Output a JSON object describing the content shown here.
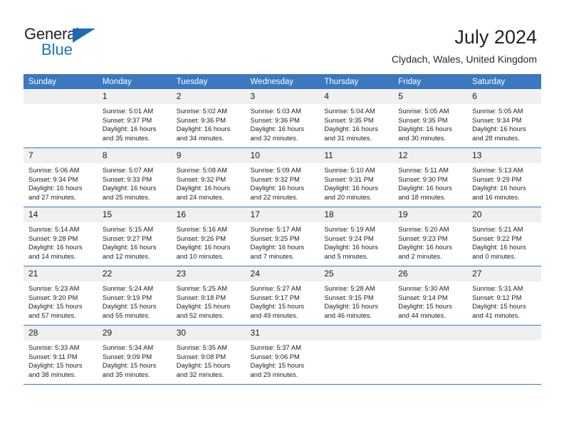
{
  "brand": {
    "name_part1": "General",
    "name_part2": "Blue"
  },
  "header": {
    "title": "July 2024",
    "location": "Clydach, Wales, United Kingdom"
  },
  "weekday_headers": [
    "Sunday",
    "Monday",
    "Tuesday",
    "Wednesday",
    "Thursday",
    "Friday",
    "Saturday"
  ],
  "colors": {
    "header_blue": "#3b78bf",
    "brand_blue": "#1b75bb",
    "daynum_bg": "#f0f0f0"
  },
  "weeks": [
    [
      {
        "day": "",
        "sunrise": "",
        "sunset": "",
        "daylight1": "",
        "daylight2": ""
      },
      {
        "day": "1",
        "sunrise": "Sunrise: 5:01 AM",
        "sunset": "Sunset: 9:37 PM",
        "daylight1": "Daylight: 16 hours",
        "daylight2": "and 35 minutes."
      },
      {
        "day": "2",
        "sunrise": "Sunrise: 5:02 AM",
        "sunset": "Sunset: 9:36 PM",
        "daylight1": "Daylight: 16 hours",
        "daylight2": "and 34 minutes."
      },
      {
        "day": "3",
        "sunrise": "Sunrise: 5:03 AM",
        "sunset": "Sunset: 9:36 PM",
        "daylight1": "Daylight: 16 hours",
        "daylight2": "and 32 minutes."
      },
      {
        "day": "4",
        "sunrise": "Sunrise: 5:04 AM",
        "sunset": "Sunset: 9:35 PM",
        "daylight1": "Daylight: 16 hours",
        "daylight2": "and 31 minutes."
      },
      {
        "day": "5",
        "sunrise": "Sunrise: 5:05 AM",
        "sunset": "Sunset: 9:35 PM",
        "daylight1": "Daylight: 16 hours",
        "daylight2": "and 30 minutes."
      },
      {
        "day": "6",
        "sunrise": "Sunrise: 5:05 AM",
        "sunset": "Sunset: 9:34 PM",
        "daylight1": "Daylight: 16 hours",
        "daylight2": "and 28 minutes."
      }
    ],
    [
      {
        "day": "7",
        "sunrise": "Sunrise: 5:06 AM",
        "sunset": "Sunset: 9:34 PM",
        "daylight1": "Daylight: 16 hours",
        "daylight2": "and 27 minutes."
      },
      {
        "day": "8",
        "sunrise": "Sunrise: 5:07 AM",
        "sunset": "Sunset: 9:33 PM",
        "daylight1": "Daylight: 16 hours",
        "daylight2": "and 25 minutes."
      },
      {
        "day": "9",
        "sunrise": "Sunrise: 5:08 AM",
        "sunset": "Sunset: 9:32 PM",
        "daylight1": "Daylight: 16 hours",
        "daylight2": "and 24 minutes."
      },
      {
        "day": "10",
        "sunrise": "Sunrise: 5:09 AM",
        "sunset": "Sunset: 9:32 PM",
        "daylight1": "Daylight: 16 hours",
        "daylight2": "and 22 minutes."
      },
      {
        "day": "11",
        "sunrise": "Sunrise: 5:10 AM",
        "sunset": "Sunset: 9:31 PM",
        "daylight1": "Daylight: 16 hours",
        "daylight2": "and 20 minutes."
      },
      {
        "day": "12",
        "sunrise": "Sunrise: 5:11 AM",
        "sunset": "Sunset: 9:30 PM",
        "daylight1": "Daylight: 16 hours",
        "daylight2": "and 18 minutes."
      },
      {
        "day": "13",
        "sunrise": "Sunrise: 5:13 AM",
        "sunset": "Sunset: 9:29 PM",
        "daylight1": "Daylight: 16 hours",
        "daylight2": "and 16 minutes."
      }
    ],
    [
      {
        "day": "14",
        "sunrise": "Sunrise: 5:14 AM",
        "sunset": "Sunset: 9:28 PM",
        "daylight1": "Daylight: 16 hours",
        "daylight2": "and 14 minutes."
      },
      {
        "day": "15",
        "sunrise": "Sunrise: 5:15 AM",
        "sunset": "Sunset: 9:27 PM",
        "daylight1": "Daylight: 16 hours",
        "daylight2": "and 12 minutes."
      },
      {
        "day": "16",
        "sunrise": "Sunrise: 5:16 AM",
        "sunset": "Sunset: 9:26 PM",
        "daylight1": "Daylight: 16 hours",
        "daylight2": "and 10 minutes."
      },
      {
        "day": "17",
        "sunrise": "Sunrise: 5:17 AM",
        "sunset": "Sunset: 9:25 PM",
        "daylight1": "Daylight: 16 hours",
        "daylight2": "and 7 minutes."
      },
      {
        "day": "18",
        "sunrise": "Sunrise: 5:19 AM",
        "sunset": "Sunset: 9:24 PM",
        "daylight1": "Daylight: 16 hours",
        "daylight2": "and 5 minutes."
      },
      {
        "day": "19",
        "sunrise": "Sunrise: 5:20 AM",
        "sunset": "Sunset: 9:23 PM",
        "daylight1": "Daylight: 16 hours",
        "daylight2": "and 2 minutes."
      },
      {
        "day": "20",
        "sunrise": "Sunrise: 5:21 AM",
        "sunset": "Sunset: 9:22 PM",
        "daylight1": "Daylight: 16 hours",
        "daylight2": "and 0 minutes."
      }
    ],
    [
      {
        "day": "21",
        "sunrise": "Sunrise: 5:23 AM",
        "sunset": "Sunset: 9:20 PM",
        "daylight1": "Daylight: 15 hours",
        "daylight2": "and 57 minutes."
      },
      {
        "day": "22",
        "sunrise": "Sunrise: 5:24 AM",
        "sunset": "Sunset: 9:19 PM",
        "daylight1": "Daylight: 15 hours",
        "daylight2": "and 55 minutes."
      },
      {
        "day": "23",
        "sunrise": "Sunrise: 5:25 AM",
        "sunset": "Sunset: 9:18 PM",
        "daylight1": "Daylight: 15 hours",
        "daylight2": "and 52 minutes."
      },
      {
        "day": "24",
        "sunrise": "Sunrise: 5:27 AM",
        "sunset": "Sunset: 9:17 PM",
        "daylight1": "Daylight: 15 hours",
        "daylight2": "and 49 minutes."
      },
      {
        "day": "25",
        "sunrise": "Sunrise: 5:28 AM",
        "sunset": "Sunset: 9:15 PM",
        "daylight1": "Daylight: 15 hours",
        "daylight2": "and 46 minutes."
      },
      {
        "day": "26",
        "sunrise": "Sunrise: 5:30 AM",
        "sunset": "Sunset: 9:14 PM",
        "daylight1": "Daylight: 15 hours",
        "daylight2": "and 44 minutes."
      },
      {
        "day": "27",
        "sunrise": "Sunrise: 5:31 AM",
        "sunset": "Sunset: 9:12 PM",
        "daylight1": "Daylight: 15 hours",
        "daylight2": "and 41 minutes."
      }
    ],
    [
      {
        "day": "28",
        "sunrise": "Sunrise: 5:33 AM",
        "sunset": "Sunset: 9:11 PM",
        "daylight1": "Daylight: 15 hours",
        "daylight2": "and 38 minutes."
      },
      {
        "day": "29",
        "sunrise": "Sunrise: 5:34 AM",
        "sunset": "Sunset: 9:09 PM",
        "daylight1": "Daylight: 15 hours",
        "daylight2": "and 35 minutes."
      },
      {
        "day": "30",
        "sunrise": "Sunrise: 5:35 AM",
        "sunset": "Sunset: 9:08 PM",
        "daylight1": "Daylight: 15 hours",
        "daylight2": "and 32 minutes."
      },
      {
        "day": "31",
        "sunrise": "Sunrise: 5:37 AM",
        "sunset": "Sunset: 9:06 PM",
        "daylight1": "Daylight: 15 hours",
        "daylight2": "and 29 minutes."
      },
      {
        "day": "",
        "sunrise": "",
        "sunset": "",
        "daylight1": "",
        "daylight2": ""
      },
      {
        "day": "",
        "sunrise": "",
        "sunset": "",
        "daylight1": "",
        "daylight2": ""
      },
      {
        "day": "",
        "sunrise": "",
        "sunset": "",
        "daylight1": "",
        "daylight2": ""
      }
    ]
  ]
}
